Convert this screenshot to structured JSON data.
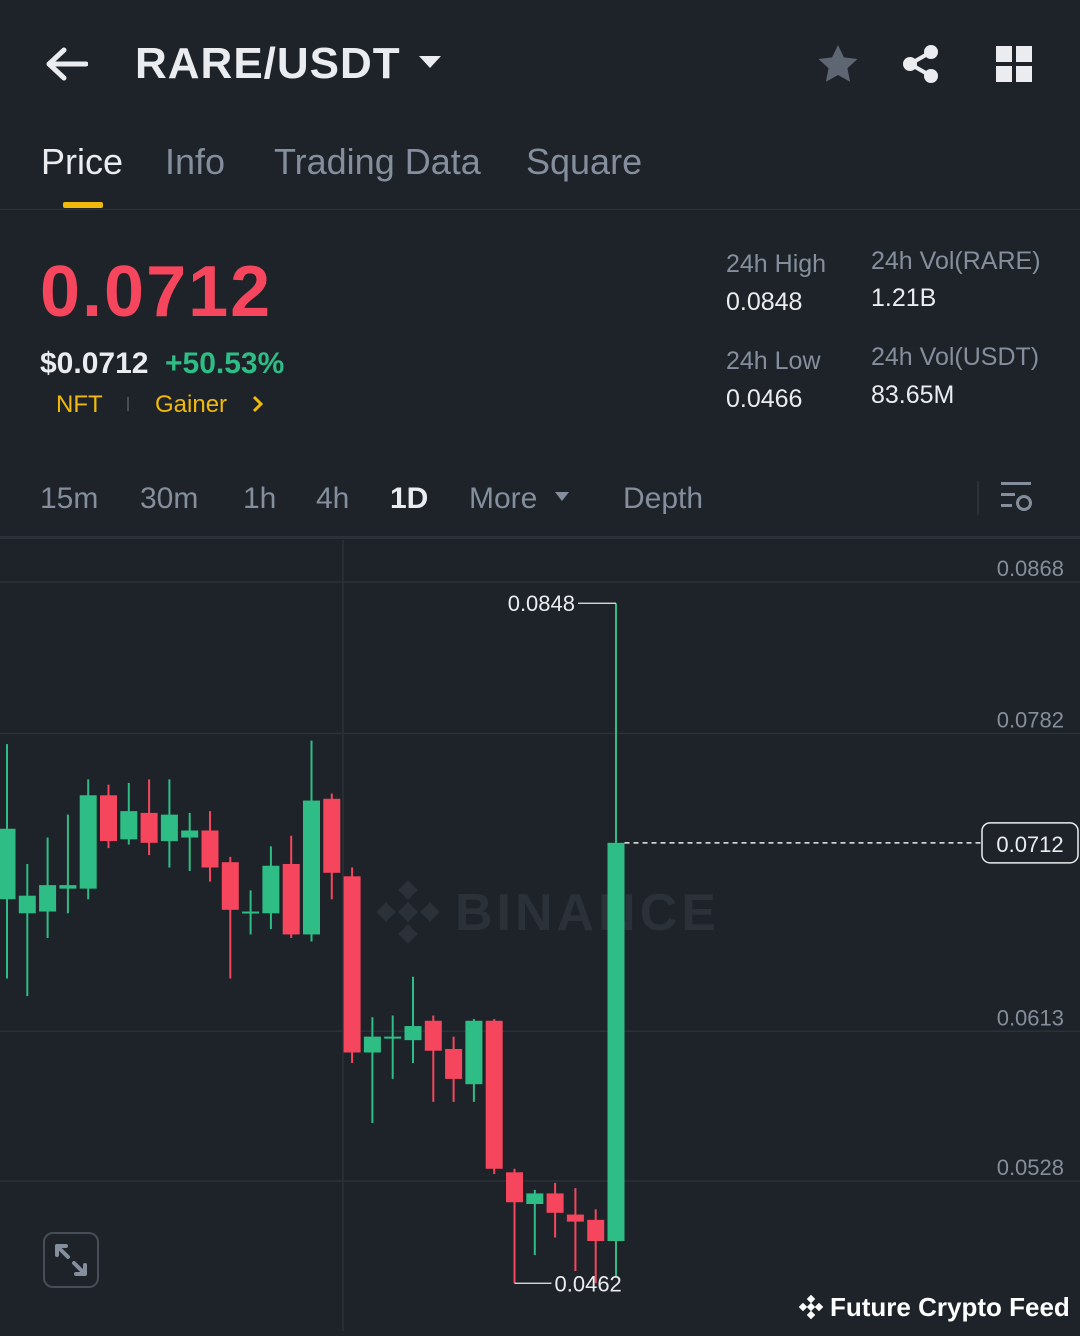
{
  "header": {
    "title": "RARE/USDT",
    "icons": [
      "arrow-left-icon",
      "caret-down-icon",
      "star-icon",
      "share-icon",
      "grid-icon"
    ]
  },
  "tabs": [
    {
      "label": "Price",
      "active": true
    },
    {
      "label": "Info",
      "active": false
    },
    {
      "label": "Trading Data",
      "active": false
    },
    {
      "label": "Square",
      "active": false
    }
  ],
  "ticker": {
    "last_price": "0.0712",
    "usd_price": "$0.0712",
    "change_pct": "+50.53%",
    "tags": [
      "NFT",
      "Gainer"
    ],
    "stats": {
      "high_label": "24h High",
      "high_value": "0.0848",
      "low_label": "24h Low",
      "low_value": "0.0466",
      "vol_base_label": "24h Vol(RARE)",
      "vol_base_value": "1.21B",
      "vol_quote_label": "24h Vol(USDT)",
      "vol_quote_value": "83.65M"
    }
  },
  "intervals": {
    "items": [
      "15m",
      "30m",
      "1h",
      "4h",
      "1D"
    ],
    "active": "1D",
    "more_label": "More",
    "depth_label": "Depth"
  },
  "colors": {
    "up": "#2ebd85",
    "down": "#f6465d",
    "accent": "#f0b90b",
    "background": "#1e2329"
  },
  "chart_data": {
    "type": "candlestick",
    "interval": "1D",
    "y_ticks": [
      "0.0868",
      "0.0782",
      "0.0613",
      "0.0528"
    ],
    "ylim": [
      0.0442,
      0.0868
    ],
    "current_price_label": "0.0712",
    "max_annotation": "0.0848",
    "min_annotation": "0.0462",
    "watermark": "BINANCE",
    "candles": [
      [
        0.068,
        0.072,
        0.0635,
        0.0768
      ],
      [
        0.0672,
        0.0682,
        0.0625,
        0.07
      ],
      [
        0.0673,
        0.0688,
        0.0658,
        0.0715
      ],
      [
        0.0686,
        0.0688,
        0.0672,
        0.0728
      ],
      [
        0.0686,
        0.0739,
        0.068,
        0.0748
      ],
      [
        0.0739,
        0.0713,
        0.0709,
        0.0745
      ],
      [
        0.0714,
        0.073,
        0.0711,
        0.0746
      ],
      [
        0.0729,
        0.0712,
        0.0705,
        0.0748
      ],
      [
        0.0713,
        0.0728,
        0.0698,
        0.0748
      ],
      [
        0.0715,
        0.0719,
        0.0696,
        0.0729
      ],
      [
        0.0719,
        0.0698,
        0.069,
        0.073
      ],
      [
        0.0701,
        0.0674,
        0.0635,
        0.0704
      ],
      [
        0.0672,
        0.0673,
        0.066,
        0.0685
      ],
      [
        0.0672,
        0.0699,
        0.0663,
        0.071
      ],
      [
        0.07,
        0.066,
        0.0658,
        0.0716
      ],
      [
        0.066,
        0.0736,
        0.0656,
        0.077
      ],
      [
        0.0737,
        0.0695,
        0.068,
        0.074
      ],
      [
        0.0693,
        0.0593,
        0.0587,
        0.0698
      ],
      [
        0.0593,
        0.0602,
        0.0553,
        0.0613
      ],
      [
        0.0602,
        0.0602,
        0.0578,
        0.0614
      ],
      [
        0.06,
        0.0608,
        0.0587,
        0.0636
      ],
      [
        0.0611,
        0.0594,
        0.0565,
        0.0614
      ],
      [
        0.0595,
        0.0578,
        0.0565,
        0.0602
      ],
      [
        0.0575,
        0.0611,
        0.0565,
        0.0612
      ],
      [
        0.0611,
        0.0527,
        0.0524,
        0.0612
      ],
      [
        0.0525,
        0.0508,
        0.0462,
        0.0527
      ],
      [
        0.0507,
        0.0513,
        0.0478,
        0.0515
      ],
      [
        0.0513,
        0.0502,
        0.0488,
        0.0519
      ],
      [
        0.0501,
        0.0497,
        0.0469,
        0.0516
      ],
      [
        0.0498,
        0.0486,
        0.0462,
        0.0504
      ],
      [
        0.0486,
        0.0712,
        0.0466,
        0.0848
      ]
    ]
  },
  "credit": "Future Crypto Feed"
}
